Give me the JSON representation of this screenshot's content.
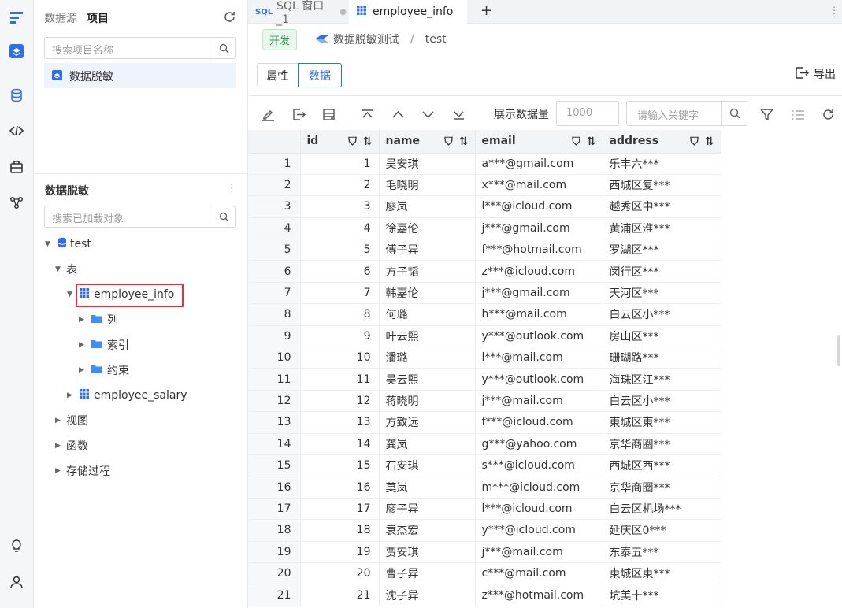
{
  "rail": {
    "icons": [
      "app-logo-icon",
      "layers-icon",
      "database-icon",
      "code-icon",
      "toolbox-icon",
      "network-icon",
      "bulb-icon",
      "user-icon"
    ]
  },
  "left": {
    "tab_datasource": "数据源",
    "tab_project": "项目",
    "project_search_placeholder": "搜索项目名称",
    "project_item": "数据脱敏",
    "section_title": "数据脱敏",
    "object_search_placeholder": "搜索已加载对象",
    "tree": {
      "db": "test",
      "tables_folder": "表",
      "table1": "employee_info",
      "sub1": "列",
      "sub2": "索引",
      "sub3": "约束",
      "table2": "employee_salary",
      "views": "视图",
      "functions": "函数",
      "procedures": "存储过程"
    }
  },
  "main": {
    "tab_sql_badge": "SQL",
    "tab_sql": "SQL 窗口_1",
    "tab_active": "employee_info",
    "env_tag": "开发",
    "breadcrumb_project": "数据脱敏测试",
    "breadcrumb_sep": "/",
    "breadcrumb_db": "test",
    "seg_props": "属性",
    "seg_data": "数据",
    "export": "导出",
    "toolbar": {
      "count_label": "展示数据量",
      "count_placeholder": "1000",
      "keyword_placeholder": "请输入关键字"
    },
    "columns": [
      "id",
      "name",
      "email",
      "address"
    ],
    "rows": [
      [
        "1",
        "1",
        "吴安琪",
        "a***@gmail.com",
        "乐丰六***"
      ],
      [
        "2",
        "2",
        "毛晓明",
        "x***@mail.com",
        "西城区复***"
      ],
      [
        "3",
        "3",
        "廖岚",
        "l***@icloud.com",
        "越秀区中***"
      ],
      [
        "4",
        "4",
        "徐嘉伦",
        "j***@gmail.com",
        "黄浦区淮***"
      ],
      [
        "5",
        "5",
        "傅子异",
        "f***@hotmail.com",
        "罗湖区***"
      ],
      [
        "6",
        "6",
        "方子韬",
        "z***@icloud.com",
        "闵行区***"
      ],
      [
        "7",
        "7",
        "韩嘉伦",
        "j***@gmail.com",
        "天河区***"
      ],
      [
        "8",
        "8",
        "何璐",
        "h***@mail.com",
        "白云区小***"
      ],
      [
        "9",
        "9",
        "叶云熙",
        "y***@outlook.com",
        "房山区***"
      ],
      [
        "10",
        "10",
        "潘璐",
        "l***@mail.com",
        "珊瑚路***"
      ],
      [
        "11",
        "11",
        "吴云熙",
        "y***@outlook.com",
        "海珠区江***"
      ],
      [
        "12",
        "12",
        "蒋晓明",
        "j***@mail.com",
        "白云区小***"
      ],
      [
        "13",
        "13",
        "方致远",
        "f***@icloud.com",
        "東城区東***"
      ],
      [
        "14",
        "14",
        "龚岚",
        "g***@yahoo.com",
        "京华商圈***"
      ],
      [
        "15",
        "15",
        "石安琪",
        "s***@icloud.com",
        "西城区西***"
      ],
      [
        "16",
        "16",
        "莫岚",
        "m***@icloud.com",
        "京华商圈***"
      ],
      [
        "17",
        "17",
        "廖子异",
        "l***@icloud.com",
        "白云区机场***"
      ],
      [
        "18",
        "18",
        "袁杰宏",
        "y***@icloud.com",
        "延庆区0***"
      ],
      [
        "19",
        "19",
        "贾安琪",
        "j***@mail.com",
        "东泰五***"
      ],
      [
        "20",
        "20",
        "曹子异",
        "c***@mail.com",
        "東城区東***"
      ],
      [
        "21",
        "21",
        "沈子异",
        "z***@hotmail.com",
        "坑美十***"
      ]
    ]
  },
  "colors": {
    "accent": "#2f6fed",
    "highlight": "#d9363e",
    "dev_tag": "#2f9a48"
  }
}
